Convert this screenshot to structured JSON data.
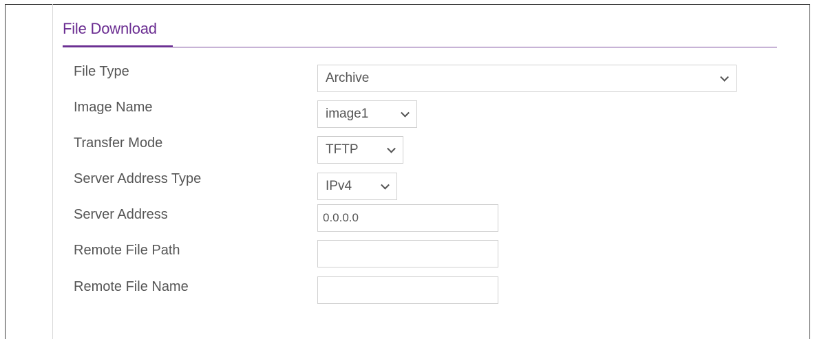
{
  "tab": {
    "title": "File Download"
  },
  "form": {
    "file_type": {
      "label": "File Type",
      "value": "Archive"
    },
    "image_name": {
      "label": "Image Name",
      "value": "image1"
    },
    "transfer_mode": {
      "label": "Transfer Mode",
      "value": "TFTP"
    },
    "server_address_type": {
      "label": "Server Address Type",
      "value": "IPv4"
    },
    "server_address": {
      "label": "Server Address",
      "value": "0.0.0.0"
    },
    "remote_file_path": {
      "label": "Remote File Path",
      "value": ""
    },
    "remote_file_name": {
      "label": "Remote File Name",
      "value": ""
    }
  },
  "colors": {
    "accent": "#6a2c91",
    "text": "#555555",
    "field_border": "#cfcfcf"
  },
  "icons": {
    "dropdown": "chevron-down-icon"
  }
}
